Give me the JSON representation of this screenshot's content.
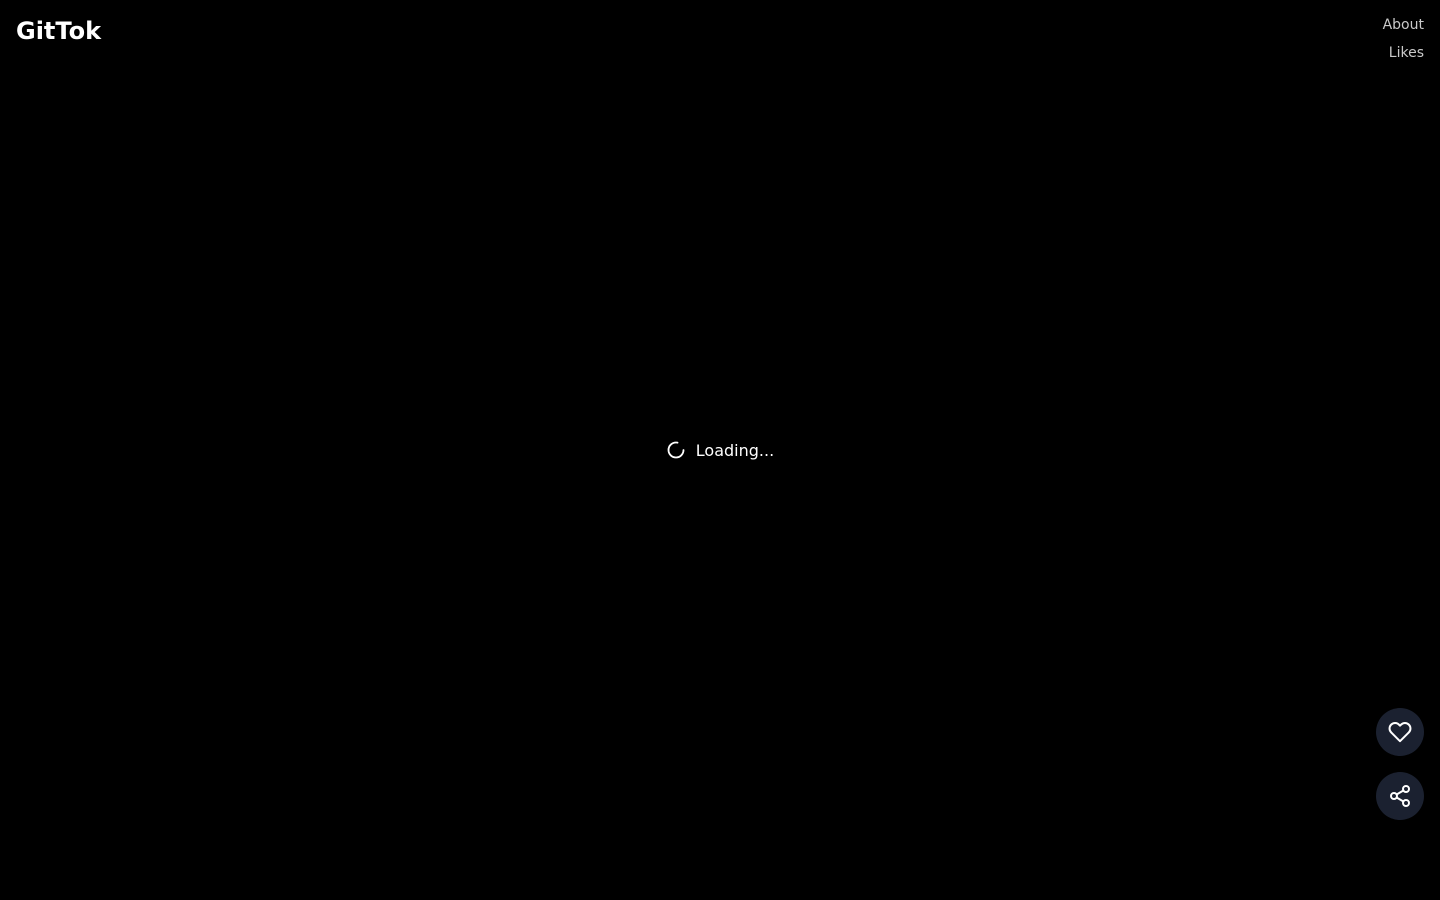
{
  "header": {
    "logo": "GitTok",
    "nav": {
      "about": "About",
      "likes": "Likes"
    }
  },
  "main": {
    "loading_text": "Loading...",
    "spinner_icon": "spinner-icon"
  },
  "actions": {
    "like_icon": "heart-icon",
    "share_icon": "share-icon"
  },
  "colors": {
    "background": "#000000",
    "button_bg": "#1b2130",
    "nav_text": "#c9c9c9",
    "text": "#ffffff"
  }
}
